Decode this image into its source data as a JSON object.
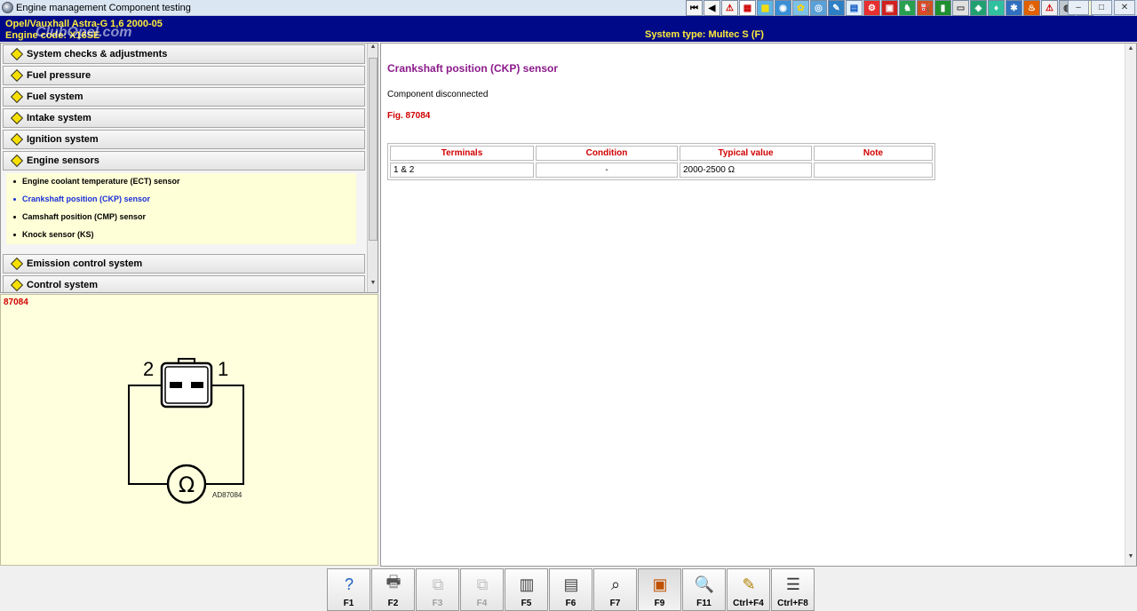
{
  "window": {
    "title": "Engine management Component testing",
    "controls": [
      "–",
      "□",
      "✕"
    ]
  },
  "toolbar": {
    "buttons": [
      {
        "name": "first-icon",
        "glyph": "⏮",
        "bg": "#f4f4f4",
        "fg": "#000"
      },
      {
        "name": "back-icon",
        "glyph": "◀",
        "bg": "#f4f4f4",
        "fg": "#000"
      },
      {
        "name": "warning-icon",
        "glyph": "⚠",
        "bg": "#f4f4f4",
        "fg": "#d00000"
      },
      {
        "name": "document-icon",
        "glyph": "▦",
        "bg": "#ffffff",
        "fg": "#c00"
      },
      {
        "name": "map-icon",
        "glyph": "▩",
        "bg": "#5fb3e3",
        "fg": "#ffe000"
      },
      {
        "name": "gauge-icon",
        "glyph": "◉",
        "bg": "#3a8fd6",
        "fg": "#fff"
      },
      {
        "name": "tools-icon",
        "glyph": "✿",
        "bg": "#7cc0e8",
        "fg": "#ffd400"
      },
      {
        "name": "disc-icon",
        "glyph": "◎",
        "bg": "#5aa0d8",
        "fg": "#fff"
      },
      {
        "name": "wrench-icon",
        "glyph": "✎",
        "bg": "#2f7fc4",
        "fg": "#fff"
      },
      {
        "name": "chart-icon",
        "glyph": "▤",
        "bg": "#e0f0ff",
        "fg": "#0050c0"
      },
      {
        "name": "engine-icon",
        "glyph": "⚙",
        "bg": "#e83030",
        "fg": "#fff"
      },
      {
        "name": "pdf-icon",
        "glyph": "▣",
        "bg": "#d02020",
        "fg": "#fff"
      },
      {
        "name": "person-icon",
        "glyph": "♞",
        "bg": "#28a050",
        "fg": "#fff"
      },
      {
        "name": "fuel-icon",
        "glyph": "⛽",
        "bg": "#d05020",
        "fg": "#fff"
      },
      {
        "name": "battery-icon",
        "glyph": "▮",
        "bg": "#209030",
        "fg": "#fff"
      },
      {
        "name": "card-icon",
        "glyph": "▭",
        "bg": "#e0e0e0",
        "fg": "#444"
      },
      {
        "name": "sensor-icon",
        "glyph": "◈",
        "bg": "#20a070",
        "fg": "#fff"
      },
      {
        "name": "diagnose-icon",
        "glyph": "♦",
        "bg": "#30c0a0",
        "fg": "#fff"
      },
      {
        "name": "fan-icon",
        "glyph": "✱",
        "bg": "#3070c0",
        "fg": "#fff"
      },
      {
        "name": "fire-icon",
        "glyph": "♨",
        "bg": "#e06000",
        "fg": "#fff"
      },
      {
        "name": "alert-icon",
        "glyph": "⚠",
        "bg": "#f0f0f0",
        "fg": "#d00000"
      },
      {
        "name": "tire-icon",
        "glyph": "◍",
        "bg": "#c0c8d0",
        "fg": "#333"
      },
      {
        "name": "note-icon",
        "glyph": "▢",
        "bg": "#ffffd0",
        "fg": "#444"
      }
    ]
  },
  "vehicle": {
    "line": "Opel/Vauxhall  Astra-G  1,6  2000-05",
    "engine": "Engine code: X16SE",
    "watermark": "ClubOpel.com",
    "system_type": "System type: Multec S (F)"
  },
  "menu": {
    "categories": [
      {
        "label": "System checks & adjustments"
      },
      {
        "label": "Fuel pressure"
      },
      {
        "label": "Fuel system"
      },
      {
        "label": "Intake system"
      },
      {
        "label": "Ignition system"
      },
      {
        "label": "Engine sensors",
        "expanded": true
      },
      {
        "label": "Emission control system"
      },
      {
        "label": "Control system"
      }
    ],
    "subitems": [
      {
        "label": "Engine coolant temperature (ECT) sensor",
        "selected": false
      },
      {
        "label": "Crankshaft position (CKP) sensor",
        "selected": true
      },
      {
        "label": "Camshaft position (CMP) sensor",
        "selected": false
      },
      {
        "label": "Knock sensor (KS)",
        "selected": false
      }
    ]
  },
  "figure": {
    "number": "87084",
    "pin_left": "2",
    "pin_right": "1",
    "meter_symbol": "Ω",
    "code": "AD87084"
  },
  "content": {
    "title": "Crankshaft position (CKP) sensor",
    "status": "Component disconnected",
    "fig_ref": "Fig. 87084",
    "table": {
      "headers": [
        "Terminals",
        "Condition",
        "Typical value",
        "Note"
      ],
      "rows": [
        [
          "1 & 2",
          "-",
          "2000-2500 Ω",
          ""
        ]
      ]
    }
  },
  "fkeys": [
    {
      "label": "F1",
      "name": "help-icon",
      "glyph": "?",
      "color": "#1a5fc0",
      "disabled": false,
      "pressed": false
    },
    {
      "label": "F2",
      "name": "printer-icon",
      "glyph": "🖶",
      "color": "#555",
      "disabled": false,
      "pressed": false
    },
    {
      "label": "F3",
      "name": "copy-icon",
      "glyph": "⧉",
      "color": "#777",
      "disabled": true,
      "pressed": false
    },
    {
      "label": "F4",
      "name": "paste-icon",
      "glyph": "⧉",
      "color": "#777",
      "disabled": true,
      "pressed": false
    },
    {
      "label": "F5",
      "name": "page-icon",
      "glyph": "▥",
      "color": "#444",
      "disabled": false,
      "pressed": false
    },
    {
      "label": "F6",
      "name": "circuit-icon",
      "glyph": "▤",
      "color": "#444",
      "disabled": false,
      "pressed": false
    },
    {
      "label": "F7",
      "name": "magnify-icon",
      "glyph": "⌕",
      "color": "#222",
      "disabled": false,
      "pressed": false
    },
    {
      "label": "F9",
      "name": "component-icon",
      "glyph": "▣",
      "color": "#c05000",
      "disabled": false,
      "pressed": true
    },
    {
      "label": "F11",
      "name": "search-icon",
      "glyph": "🔍",
      "color": "#c02020",
      "disabled": false,
      "pressed": false
    },
    {
      "label": "Ctrl+F4",
      "name": "notes-icon",
      "glyph": "✎",
      "color": "#b08000",
      "disabled": false,
      "pressed": false
    },
    {
      "label": "Ctrl+F8",
      "name": "list-icon",
      "glyph": "☰",
      "color": "#333",
      "disabled": false,
      "pressed": false
    }
  ]
}
